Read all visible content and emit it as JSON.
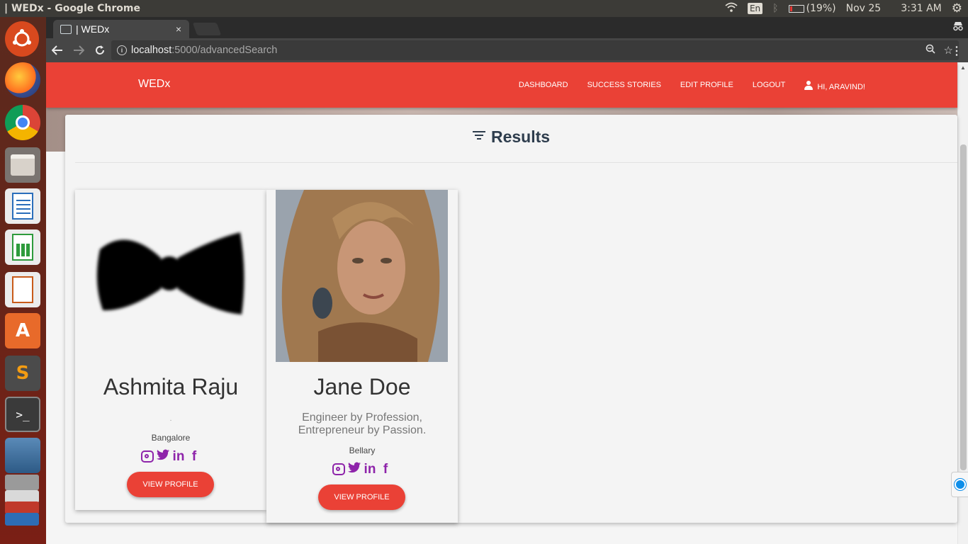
{
  "system": {
    "window_title": "| WEDx - Google Chrome",
    "keyboard": "En",
    "battery": "(19%)",
    "date": "Nov 25",
    "time": "3:31 AM"
  },
  "launcher": {
    "apps": [
      "ubuntu-dash",
      "firefox",
      "chrome",
      "files",
      "writer",
      "calc",
      "impress",
      "software-center",
      "sublime-text",
      "terminal",
      "mysql-workbench"
    ]
  },
  "browser": {
    "tab_title": "| WEDx",
    "tab_close": "×",
    "url_host": "localhost",
    "url_rest": ":5000/advancedSearch"
  },
  "site": {
    "brand": "WEDx",
    "nav": {
      "dashboard": "DASHBOARD",
      "success_stories": "SUCCESS STORIES",
      "edit_profile": "EDIT PROFILE",
      "logout": "LOGOUT",
      "greeting": "HI, ARAVIND!"
    },
    "results_title": "Results",
    "colors": {
      "primary": "#ea4136",
      "social": "#8e24aa",
      "heading": "#2e3d4d"
    }
  },
  "cards": [
    {
      "name": "Ashmita Raju",
      "bio": ".",
      "city": "Bangalore",
      "photo": "bow-tie-placeholder",
      "button": "VIEW PROFILE"
    },
    {
      "name": "Jane Doe",
      "bio": "Engineer by Profession, Entrepreneur by Passion.",
      "city": "Bellary",
      "photo": "woman-portrait",
      "button": "VIEW PROFILE"
    }
  ],
  "socials": {
    "twitter": "🐦",
    "linkedin": "in",
    "facebook": "f"
  }
}
